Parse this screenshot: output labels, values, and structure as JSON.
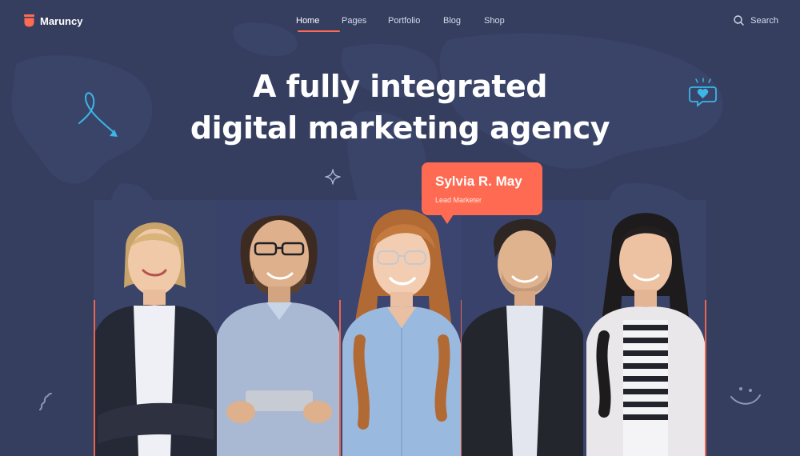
{
  "brand": {
    "name": "Maruncy",
    "accent": "#ff6a52",
    "background": "#353e5f"
  },
  "nav": {
    "items": [
      {
        "label": "Home",
        "active": true
      },
      {
        "label": "Pages",
        "active": false
      },
      {
        "label": "Portfolio",
        "active": false
      },
      {
        "label": "Blog",
        "active": false
      },
      {
        "label": "Shop",
        "active": false
      }
    ],
    "search_label": "Search",
    "search_icon": "search-icon"
  },
  "hero": {
    "headline_line1": "A fully integrated",
    "headline_line2": "digital marketing agency"
  },
  "featured": {
    "name": "Sylvia R. May",
    "role": "Lead Marketer"
  },
  "team": [
    {
      "portrait": "woman-black-blazer-portrait",
      "highlighted": false
    },
    {
      "portrait": "man-glasses-tablet-portrait",
      "highlighted": false
    },
    {
      "portrait": "woman-glasses-blue-shirt-portrait",
      "highlighted": true
    },
    {
      "portrait": "man-dark-jacket-portrait",
      "highlighted": false
    },
    {
      "portrait": "woman-striped-shirt-portrait",
      "highlighted": false
    }
  ],
  "decorations": [
    "loop-arrow-icon",
    "heart-chat-icon",
    "sparkle-icon",
    "squiggle-icon",
    "smile-icon"
  ]
}
